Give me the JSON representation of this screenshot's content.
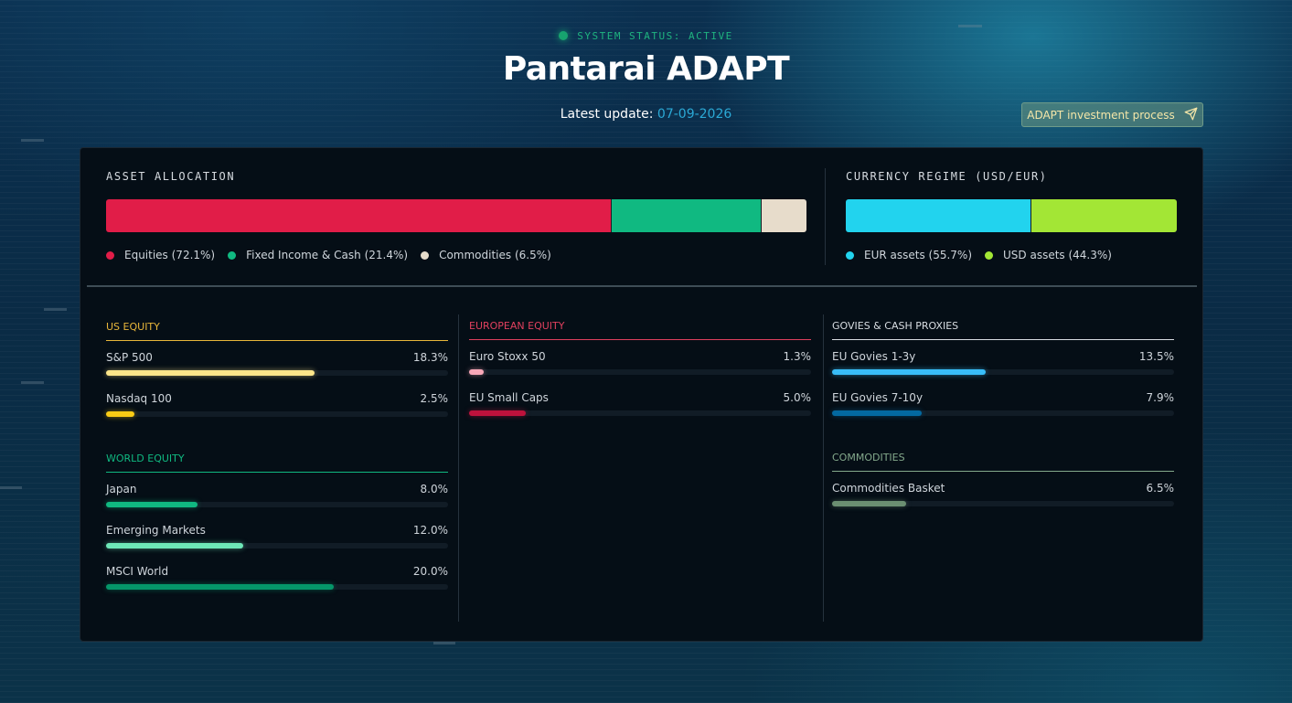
{
  "header": {
    "status": "SYSTEM STATUS: ACTIVE",
    "title": "Pantarai ADAPT",
    "update_label": "Latest update:",
    "update_date": "07-09-2026",
    "process_button": "ADAPT investment process",
    "process_icon": "send-icon"
  },
  "allocation": {
    "title": "ASSET ALLOCATION",
    "segments": [
      {
        "label": "Equities (72.1%)",
        "value": 72.1,
        "color": "#e11d48"
      },
      {
        "label": "Fixed Income & Cash (21.4%)",
        "value": 21.4,
        "color": "#10b981"
      },
      {
        "label": "Commodities (6.5%)",
        "value": 6.5,
        "color": "#e7dccb"
      }
    ]
  },
  "currency": {
    "title": "CURRENCY REGIME (USD/EUR)",
    "segments": [
      {
        "label": "EUR assets (55.7%)",
        "value": 55.7,
        "color": "#22d3ee"
      },
      {
        "label": "USD assets (44.3%)",
        "value": 44.3,
        "color": "#a3e635"
      }
    ]
  },
  "columns": [
    {
      "groups": [
        {
          "title": "US EQUITY",
          "color": "#e8b63a",
          "items": [
            {
              "name": "S&P 500",
              "pct": "18.3%",
              "value": 18.3,
              "color": "#fde68a"
            },
            {
              "name": "Nasdaq 100",
              "pct": "2.5%",
              "value": 2.5,
              "color": "#facc15"
            }
          ]
        },
        {
          "title": "WORLD EQUITY",
          "color": "#10b981",
          "items": [
            {
              "name": "Japan",
              "pct": "8.0%",
              "value": 8.0,
              "color": "#10b981"
            },
            {
              "name": "Emerging Markets",
              "pct": "12.0%",
              "value": 12.0,
              "color": "#6ee7b7"
            },
            {
              "name": "MSCI World",
              "pct": "20.0%",
              "value": 20.0,
              "color": "#059669"
            }
          ]
        }
      ]
    },
    {
      "groups": [
        {
          "title": "EUROPEAN EQUITY",
          "color": "#e0405e",
          "items": [
            {
              "name": "Euro Stoxx 50",
              "pct": "1.3%",
              "value": 1.3,
              "color": "#f9a8b8"
            },
            {
              "name": "EU Small Caps",
              "pct": "5.0%",
              "value": 5.0,
              "color": "#be123c"
            }
          ]
        }
      ]
    },
    {
      "groups": [
        {
          "title": "GOVIES & CASH PROXIES",
          "color": "#d8dde2",
          "items": [
            {
              "name": "EU Govies 1-3y",
              "pct": "13.5%",
              "value": 13.5,
              "color": "#38bdf8"
            },
            {
              "name": "EU Govies 7-10y",
              "pct": "7.9%",
              "value": 7.9,
              "color": "#0369a1"
            }
          ]
        },
        {
          "title": "COMMODITIES",
          "color": "#84a98c",
          "items": [
            {
              "name": "Commodities Basket",
              "pct": "6.5%",
              "value": 6.5,
              "color": "#6b8f71"
            }
          ]
        }
      ]
    }
  ]
}
